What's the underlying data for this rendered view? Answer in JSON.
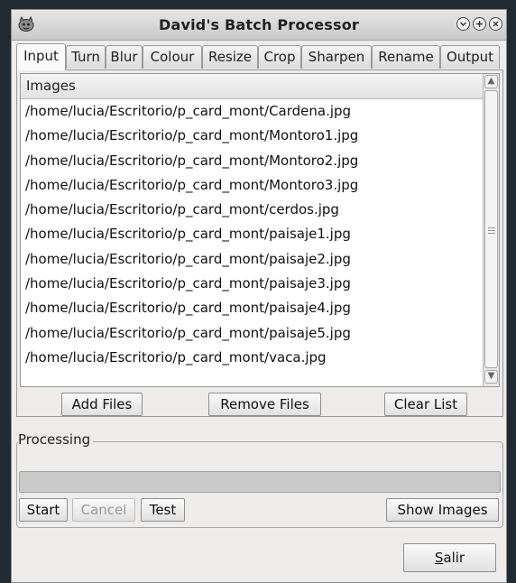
{
  "window": {
    "title": "David's Batch Processor",
    "buttons": [
      "minimize",
      "maximize",
      "close"
    ]
  },
  "tabs": [
    {
      "label": "Input",
      "active": true
    },
    {
      "label": "Turn"
    },
    {
      "label": "Blur"
    },
    {
      "label": "Colour"
    },
    {
      "label": "Resize"
    },
    {
      "label": "Crop"
    },
    {
      "label": "Sharpen"
    },
    {
      "label": "Rename"
    },
    {
      "label": "Output"
    }
  ],
  "images": {
    "header": "Images",
    "files": [
      "/home/lucia/Escritorio/p_card_mont/Cardena.jpg",
      "/home/lucia/Escritorio/p_card_mont/Montoro1.jpg",
      "/home/lucia/Escritorio/p_card_mont/Montoro2.jpg",
      "/home/lucia/Escritorio/p_card_mont/Montoro3.jpg",
      "/home/lucia/Escritorio/p_card_mont/cerdos.jpg",
      "/home/lucia/Escritorio/p_card_mont/paisaje1.jpg",
      "/home/lucia/Escritorio/p_card_mont/paisaje2.jpg",
      "/home/lucia/Escritorio/p_card_mont/paisaje3.jpg",
      "/home/lucia/Escritorio/p_card_mont/paisaje4.jpg",
      "/home/lucia/Escritorio/p_card_mont/paisaje5.jpg",
      "/home/lucia/Escritorio/p_card_mont/vaca.jpg"
    ],
    "add_files": "Add Files",
    "remove_files": "Remove Files",
    "clear_list": "Clear List"
  },
  "processing": {
    "label": "Processing",
    "progress": 0,
    "start": "Start",
    "cancel": "Cancel",
    "test": "Test",
    "show_images": "Show Images"
  },
  "footer": {
    "quit_mnemonic": "S",
    "quit_rest": "alir"
  },
  "colors": {
    "window_bg": "#edeceb",
    "desktop_bg": "#1f2a33",
    "progress_trough": "#c9c9c9"
  }
}
